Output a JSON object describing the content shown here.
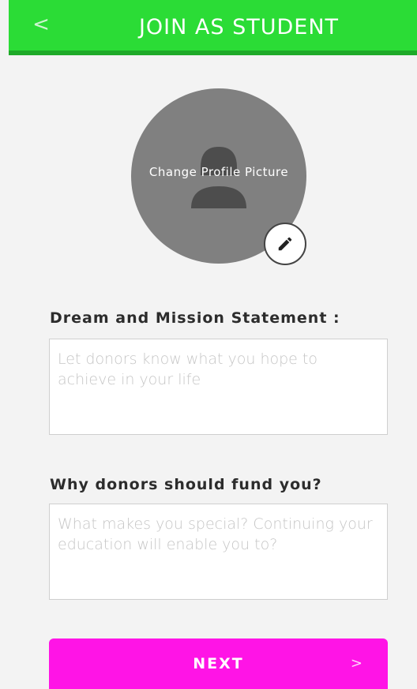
{
  "header": {
    "title": "JOIN AS STUDENT",
    "back_icon": "chevron-left-icon",
    "back_glyph": "<",
    "color": "#2bdc36"
  },
  "profile": {
    "change_picture_label": "Change Profile Picture",
    "edit_icon": "pencil-icon"
  },
  "form": {
    "mission": {
      "label": "Dream and Mission Statement :",
      "placeholder": "Let donors know what you hope to achieve in your life",
      "value": ""
    },
    "why_fund": {
      "label": "Why donors should fund you?",
      "placeholder": "What makes you special? Continuing your education will enable you to?",
      "value": ""
    }
  },
  "next_button": {
    "label": "NEXT",
    "chevron_glyph": ">",
    "chevron_icon": "chevron-right-icon",
    "color": "#ff14e6"
  }
}
